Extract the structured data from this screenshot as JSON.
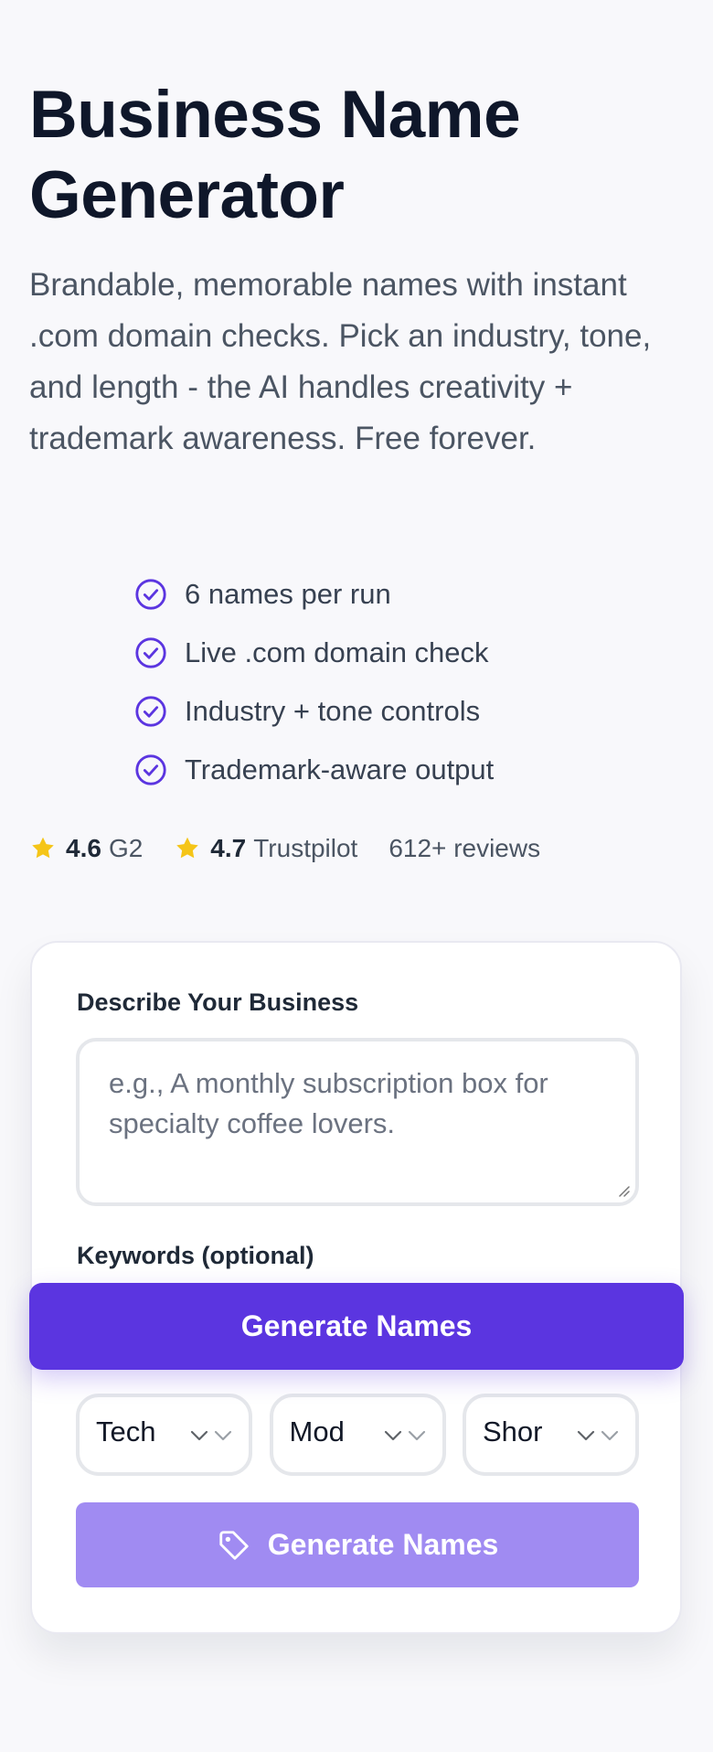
{
  "hero": {
    "title": "Business Name Generator",
    "description": "Brandable, memorable names with instant .com domain checks. Pick an industry, tone, and length - the AI handles creativity + trademark awareness. Free forever."
  },
  "features": [
    {
      "label": "6 names per run",
      "icon": "check-circle-icon"
    },
    {
      "label": "Live .com domain check",
      "icon": "check-circle-icon"
    },
    {
      "label": "Industry + tone controls",
      "icon": "check-circle-icon"
    },
    {
      "label": "Trademark-aware output",
      "icon": "check-circle-icon"
    }
  ],
  "ratings": {
    "g2_score": "4.6",
    "g2_label": "G2",
    "trustpilot_score": "4.7",
    "trustpilot_label": "Trustpilot",
    "reviews": "612+ reviews",
    "star_icon": "star-icon"
  },
  "form": {
    "business_label": "Describe Your Business",
    "business_placeholder": "e.g., A monthly subscription box for specialty coffee lovers.",
    "keywords_label": "Keywords (optional)",
    "industry_select": "Tech",
    "tone_select": "Mod",
    "length_select": "Shor",
    "generate_label": "Generate Names",
    "generate_icon": "tag-icon"
  },
  "sticky": {
    "generate_label": "Generate Names"
  },
  "colors": {
    "brand": "#5b35e0",
    "brand_light": "#a08bf2",
    "check": "#5b35e0",
    "star": "#f5c518"
  }
}
